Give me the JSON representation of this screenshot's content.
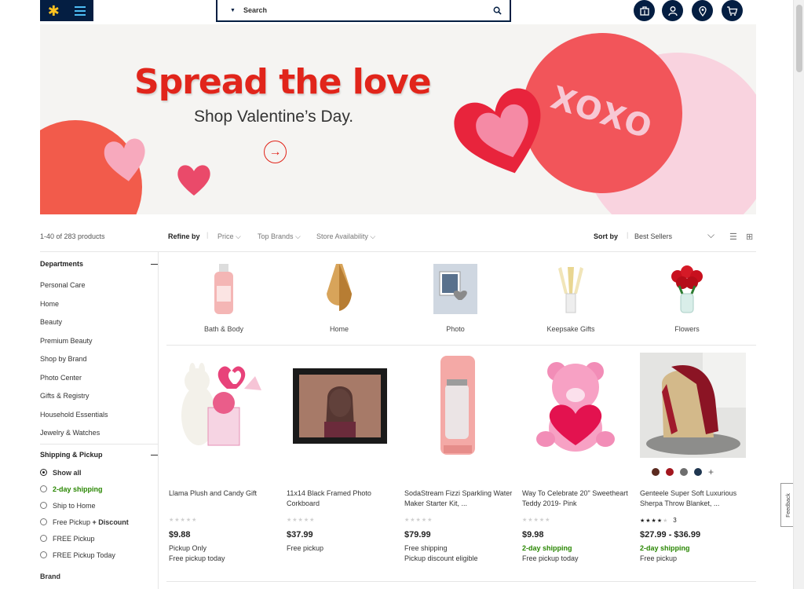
{
  "header": {
    "search_placeholder": "Search",
    "icons": [
      "store-icon",
      "account-icon",
      "location-icon",
      "cart-icon"
    ]
  },
  "banner": {
    "title": "Spread the love",
    "subtitle": "Shop Valentine’s Day.",
    "badge": "XOXO"
  },
  "results": {
    "count": "1-40 of 283 products",
    "refine_label": "Refine by",
    "filters": [
      "Price",
      "Top Brands",
      "Store Availability"
    ],
    "sort_label": "Sort by",
    "sort_value": "Best Sellers"
  },
  "sidebar": {
    "departments_title": "Departments",
    "departments": [
      "Personal Care",
      "Home",
      "Beauty",
      "Premium Beauty",
      "Shop by Brand",
      "Photo Center",
      "Gifts & Registry",
      "Household Essentials",
      "Jewelry & Watches"
    ],
    "shipping_title": "Shipping & Pickup",
    "shipping_options": [
      {
        "label": "Show all",
        "selected": true
      },
      {
        "label": "2-day shipping",
        "selected": false
      },
      {
        "label": "Ship to Home",
        "selected": false
      },
      {
        "label": "Free Pickup",
        "extra": "+ Discount",
        "selected": false
      },
      {
        "label": "FREE Pickup",
        "selected": false
      },
      {
        "label": "FREE Pickup Today",
        "selected": false
      }
    ],
    "next_section": "Brand"
  },
  "categories": [
    "Bath & Body",
    "Home",
    "Photo",
    "Keepsake Gifts",
    "Flowers"
  ],
  "products": [
    {
      "name": "Llama Plush and Candy Gift",
      "price": "$9.88",
      "line1": "Pickup Only",
      "line2": "Free pickup today",
      "rating_count": ""
    },
    {
      "name": "11x14 Black Framed Photo Corkboard",
      "price": "$37.99",
      "line1": "Free pickup",
      "line2": "",
      "rating_count": ""
    },
    {
      "name": "SodaStream Fizzi Sparkling Water Maker Starter Kit, ...",
      "price": "$79.99",
      "line1": "Free shipping",
      "line2": "Pickup discount eligible",
      "rating_count": ""
    },
    {
      "name": "Way To Celebrate 20\" Sweetheart Teddy 2019- Pink",
      "price": "$9.98",
      "line1": "2-day shipping",
      "line2": "Free pickup today",
      "rating_count": ""
    },
    {
      "name": "Genteele Super Soft Luxurious Sherpa Throw Blanket, ...",
      "price": "$27.99 - $36.99",
      "line1": "2-day shipping",
      "line2": "Free pickup",
      "rating_count": "3"
    }
  ],
  "swatch_colors": [
    "#5b2a20",
    "#a3161e",
    "#6e6e6e",
    "#1f3650"
  ],
  "swatch_more": "+",
  "feedback": "Feedback",
  "colors": {
    "brand_blue": "#041e42",
    "accent_red": "#e1251b",
    "green": "#2a8703",
    "yellow": "#ffc220"
  }
}
